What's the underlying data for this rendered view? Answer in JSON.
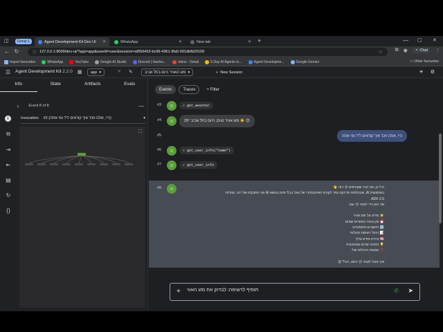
{
  "browser": {
    "tab_group": "Group 1",
    "tabs": [
      {
        "title": "Agent Development Kit Dev UI",
        "active": true
      },
      {
        "title": "WhatsApp",
        "active": false
      },
      {
        "title": "New tab",
        "active": false
      }
    ],
    "url": "127.0.0.1:8000/dev-ui/?app=app&userId=user&session=af556452-bc99-4361-9fa5-591dbfb20109",
    "chat_label": "Chat",
    "bookmarks": [
      "Import favourites",
      "WhatsApp",
      "YouTube",
      "Google AI Studio",
      "Discord | #welco...",
      "Inbox - Gmail",
      "5-Day AI Agents In...",
      "Agent Developme...",
      "Google Gemini"
    ],
    "other_favourites": "Other favourites"
  },
  "app": {
    "brand": "Agent Development Kit",
    "version": "2.2.0",
    "app_name": "app",
    "session_title": "מזג האוויר היום בתל אביב",
    "new_session": "New Session"
  },
  "left": {
    "tabs": [
      "Info",
      "State",
      "Artifacts",
      "Evals"
    ],
    "event_label": "Event 8 of 8",
    "invocation_label": "Invocation:",
    "invocation_value": "#2 (היי, אתה זוכר איך קוראים לי? ומי אתה)"
  },
  "main": {
    "tab_events": "Events",
    "tab_traces": "Traces",
    "filter": "Filter",
    "rows": [
      {
        "num": "#3",
        "fn": "get_weather"
      },
      {
        "num": "#4",
        "bubble": "25° מזג אוויר נעים, היום בתל אביב ☀️ 😊"
      },
      {
        "num": "#5"
      },
      {
        "num": "#6",
        "fn": "get_user_info(\"name\")"
      },
      {
        "num": "#7",
        "fn": "get_user_info"
      },
      {
        "num": "#8"
      }
    ],
    "user_bubble": "היי, אתה זוכר איך קוראים לי? ומי אתה",
    "msg8_lines": [
      "היי! כן, אני זוכר שקוראים לך רוני 👋",
      "באמצעות AI, שבנה/תה פרויקט גמר לקורס האינטנסיבי של גוגל בן 5 ימים בנושא AI אני הסוכן/ת של רוני, עוזר/ת",
      "ADK 2.0.",
      "אני כאן כדי לעזור לך עם:",
      "",
      "☀️ מידע על מזג אוויר",
      "⏰ זמן נוכחי באזורים שונים",
      "🔢 חישובים מתמטיים",
      "📝 ניהול רשימת מטלות",
      "🧠 זכירת מידע עליך",
      "💡 טיפים יומיים ומוטיבציה",
      "❓ הצעות היכולות שלי",
      "",
      "איך אוכל לעזור לך היום, רוני? 😊"
    ],
    "input_value": "תוסיף לרשימה: לבדוק את מזג האווי"
  },
  "colors": {
    "accent_green": "#5a9e3a",
    "user_bubble": "#3d4f7a",
    "highlight_row": "#474b54"
  }
}
